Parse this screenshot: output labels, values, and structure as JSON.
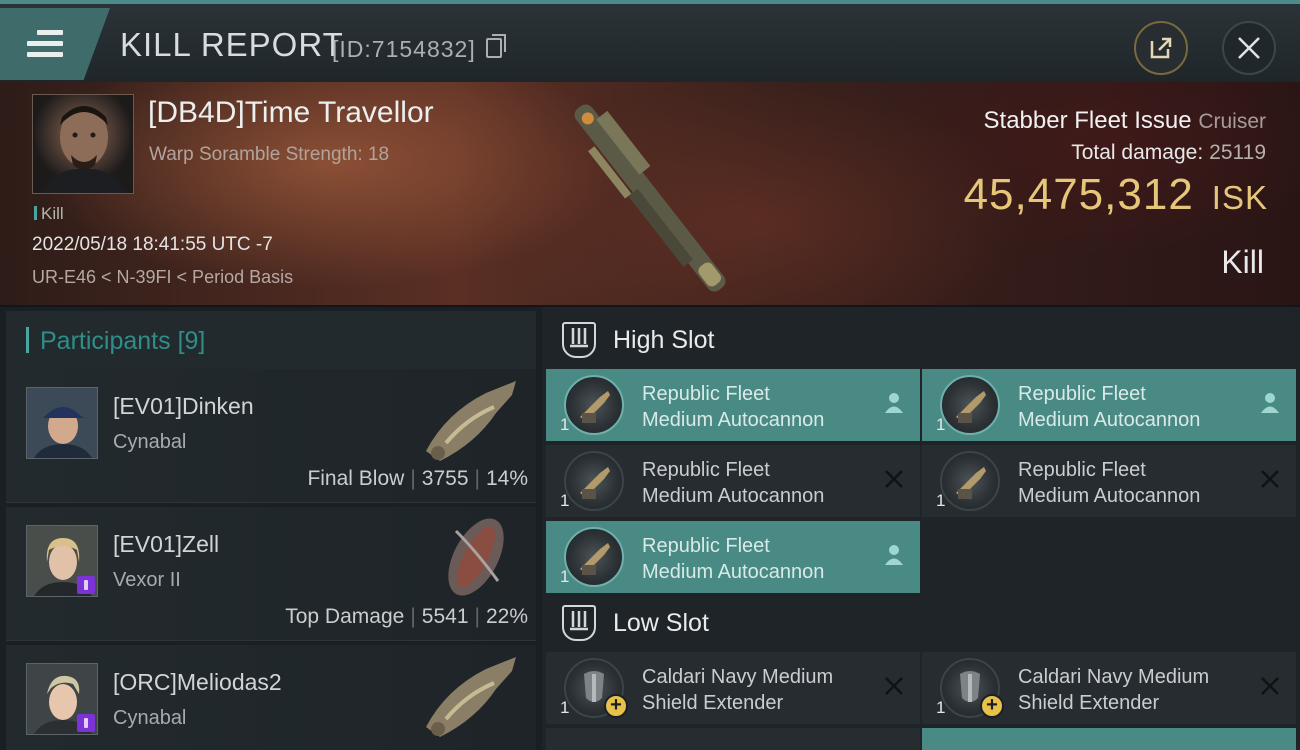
{
  "header": {
    "title": "KILL REPORT",
    "report_id": "[ID:7154832]",
    "icons": {
      "menu": "hamburger-menu-icon",
      "copy": "copy-icon",
      "share": "share-export-icon",
      "close": "close-icon"
    }
  },
  "victim": {
    "name": "[DB4D]Time Travellor",
    "warp_scramble": "Warp Soramble Strength: 18",
    "tag": "Kill",
    "datetime": "2022/05/18 18:41:55 UTC -7",
    "location": "UR-E46 < N-39FI < Period Basis",
    "ship_name": "Stabber Fleet Issue",
    "ship_class": "Cruiser",
    "total_damage_label": "Total damage:",
    "total_damage": "25119",
    "isk_value": "45,475,312",
    "isk_unit": "ISK",
    "result": "Kill"
  },
  "participants": {
    "label": "Participants",
    "count": "[9]",
    "items": [
      {
        "name": "[EV01]Dinken",
        "ship": "Cynabal",
        "role": "Final Blow",
        "damage": "3755",
        "percent": "14%"
      },
      {
        "name": "[EV01]Zell",
        "ship": "Vexor II",
        "role": "Top Damage",
        "damage": "5541",
        "percent": "22%"
      },
      {
        "name": "[ORC]Meliodas2",
        "ship": "Cynabal",
        "role": "",
        "damage": "",
        "percent": ""
      }
    ]
  },
  "slots": {
    "high": {
      "title": "High Slot",
      "modules": [
        {
          "line1": "Republic Fleet",
          "line2": "Medium Autocannon",
          "qty": "1",
          "status": "dropped"
        },
        {
          "line1": "Republic Fleet",
          "line2": "Medium Autocannon",
          "qty": "1",
          "status": "dropped"
        },
        {
          "line1": "Republic Fleet",
          "line2": "Medium Autocannon",
          "qty": "1",
          "status": "destroyed"
        },
        {
          "line1": "Republic Fleet",
          "line2": "Medium Autocannon",
          "qty": "1",
          "status": "destroyed"
        },
        {
          "line1": "Republic Fleet",
          "line2": "Medium Autocannon",
          "qty": "1",
          "status": "dropped"
        }
      ]
    },
    "low": {
      "title": "Low Slot",
      "modules": [
        {
          "line1": "Caldari Navy Medium",
          "line2": "Shield Extender",
          "qty": "1",
          "status": "destroyed"
        },
        {
          "line1": "Caldari Navy Medium",
          "line2": "Shield Extender",
          "qty": "1",
          "status": "destroyed"
        }
      ]
    }
  },
  "colors": {
    "accent": "#4a8a84",
    "isk": "#e6c77a",
    "header_accent": "#3f6c6a",
    "badge_purple": "#7b32d6"
  }
}
